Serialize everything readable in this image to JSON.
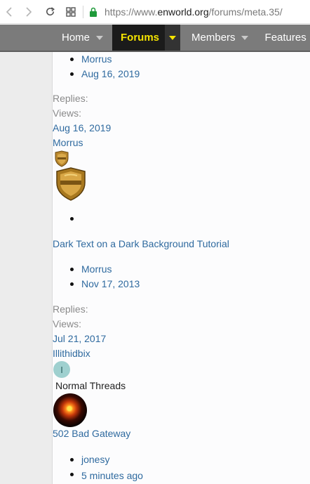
{
  "browser": {
    "url_prefix": "https://www.",
    "url_host": "enworld.org",
    "url_path": "/forums/meta.35/"
  },
  "nav": {
    "items": [
      {
        "label": "Home"
      },
      {
        "label": "Forums"
      },
      {
        "label": "Members"
      },
      {
        "label": "Features"
      }
    ]
  },
  "threads": {
    "top_author": "Morrus",
    "top_date": "Aug 16, 2019",
    "t1": {
      "replies_label": "Replies:",
      "views_label": "Views:",
      "last_date": "Aug 16, 2019",
      "last_user": "Morrus"
    },
    "t2": {
      "title": "Dark Text on a Dark Background Tutorial",
      "author": "Morrus",
      "date": "Nov 17, 2013",
      "replies_label": "Replies:",
      "views_label": "Views:",
      "last_date": "Jul 21, 2017",
      "last_user": "Illithidbix",
      "avatar_letter": "I"
    },
    "section_label": "Normal Threads",
    "t3": {
      "title": "502 Bad Gateway",
      "author": "jonesy",
      "time": "5 minutes ago"
    }
  }
}
